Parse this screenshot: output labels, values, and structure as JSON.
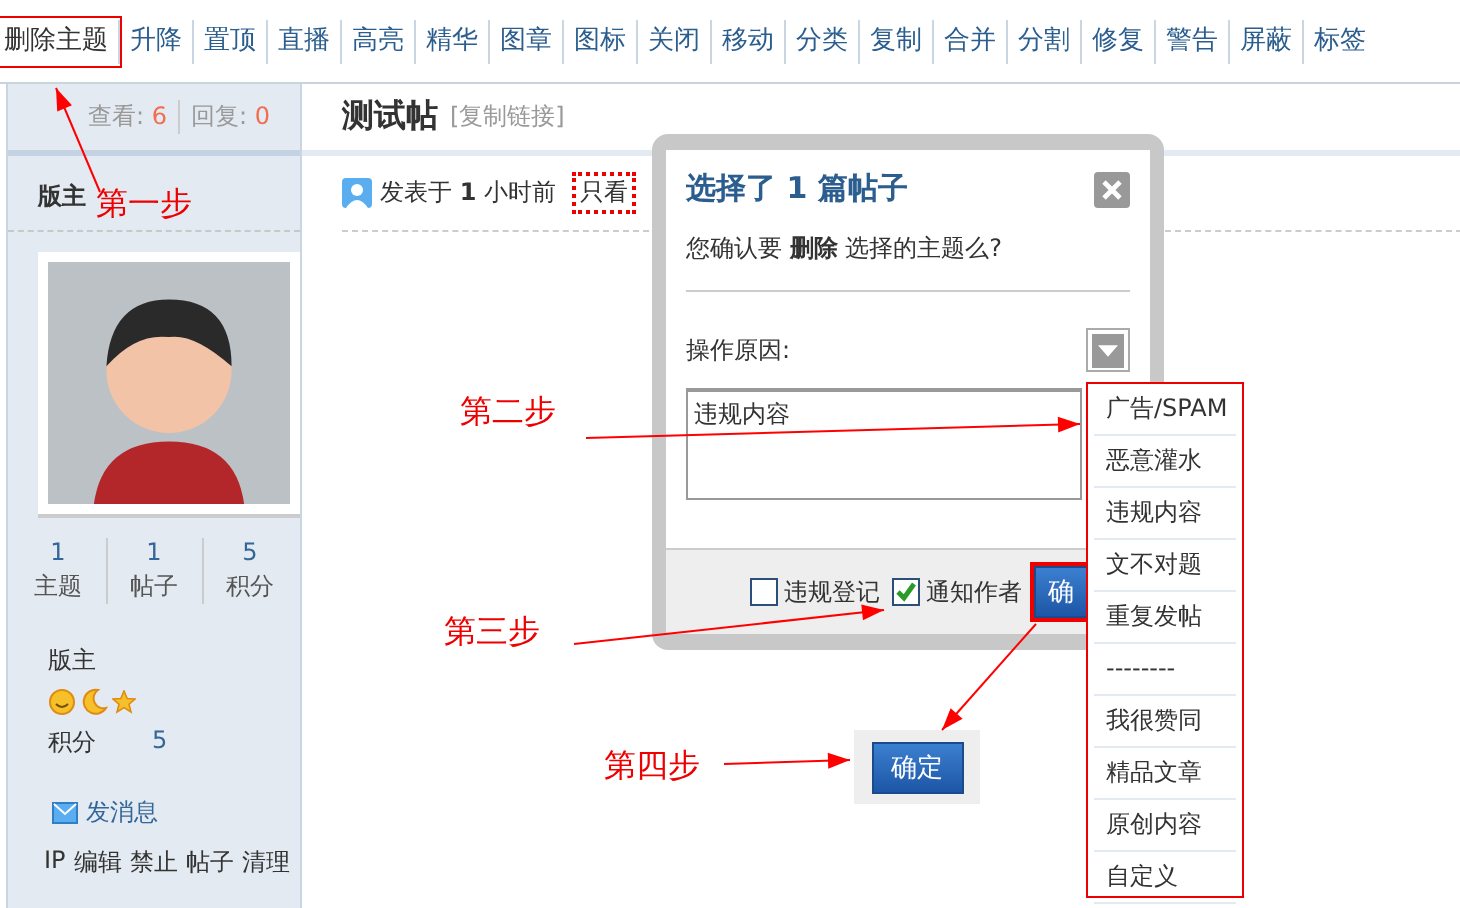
{
  "toolbar": {
    "actions": [
      {
        "label": "删除主题",
        "highlighted": true
      },
      {
        "label": "升降",
        "highlighted": false
      },
      {
        "label": "置顶",
        "highlighted": false
      },
      {
        "label": "直播",
        "highlighted": false
      },
      {
        "label": "高亮",
        "highlighted": false
      },
      {
        "label": "精华",
        "highlighted": false
      },
      {
        "label": "图章",
        "highlighted": false
      },
      {
        "label": "图标",
        "highlighted": false
      },
      {
        "label": "关闭",
        "highlighted": false
      },
      {
        "label": "移动",
        "highlighted": false
      },
      {
        "label": "分类",
        "highlighted": false
      },
      {
        "label": "复制",
        "highlighted": false
      },
      {
        "label": "合并",
        "highlighted": false
      },
      {
        "label": "分割",
        "highlighted": false
      },
      {
        "label": "修复",
        "highlighted": false
      },
      {
        "label": "警告",
        "highlighted": false
      },
      {
        "label": "屏蔽",
        "highlighted": false
      },
      {
        "label": "标签",
        "highlighted": false
      }
    ]
  },
  "sidebar": {
    "stats": [
      {
        "label": "查看:",
        "value": "6"
      },
      {
        "label": "回复:",
        "value": "0"
      }
    ],
    "author": "版主",
    "counts": [
      {
        "value": "1",
        "label": "主题"
      },
      {
        "value": "1",
        "label": "帖子"
      },
      {
        "value": "5",
        "label": "积分"
      }
    ],
    "group": "版主",
    "points": {
      "label": "积分",
      "value": "5"
    },
    "message_link": "发消息",
    "admin_links": [
      "IP",
      "编辑",
      "禁止",
      "帖子",
      "清理"
    ]
  },
  "post": {
    "title": "测试帖",
    "copy_link": "[复制链接]",
    "posted": "发表于 **1** 小时前",
    "only_author": "只看"
  },
  "dialog": {
    "title": "选择了 1 篇帖子",
    "message": "您确认要 **删除** 选择的主题么?",
    "reason_label": "操作原因:",
    "reason_value": "违规内容",
    "options": [
      {
        "label": "违规登记",
        "checked": false
      },
      {
        "label": "通知作者",
        "checked": true
      }
    ],
    "confirm": {
      "label": "确",
      "highlighted": true
    }
  },
  "reason_menu": {
    "items": [
      "广告/SPAM",
      "恶意灌水",
      "违规内容",
      "文不对题",
      "重复发帖",
      "--------",
      "我很赞同",
      "精品文章",
      "原创内容",
      "自定义"
    ]
  },
  "confirm_example": "确定",
  "annotations": [
    "第一步",
    "第二步",
    "第三步",
    "第四步"
  ]
}
